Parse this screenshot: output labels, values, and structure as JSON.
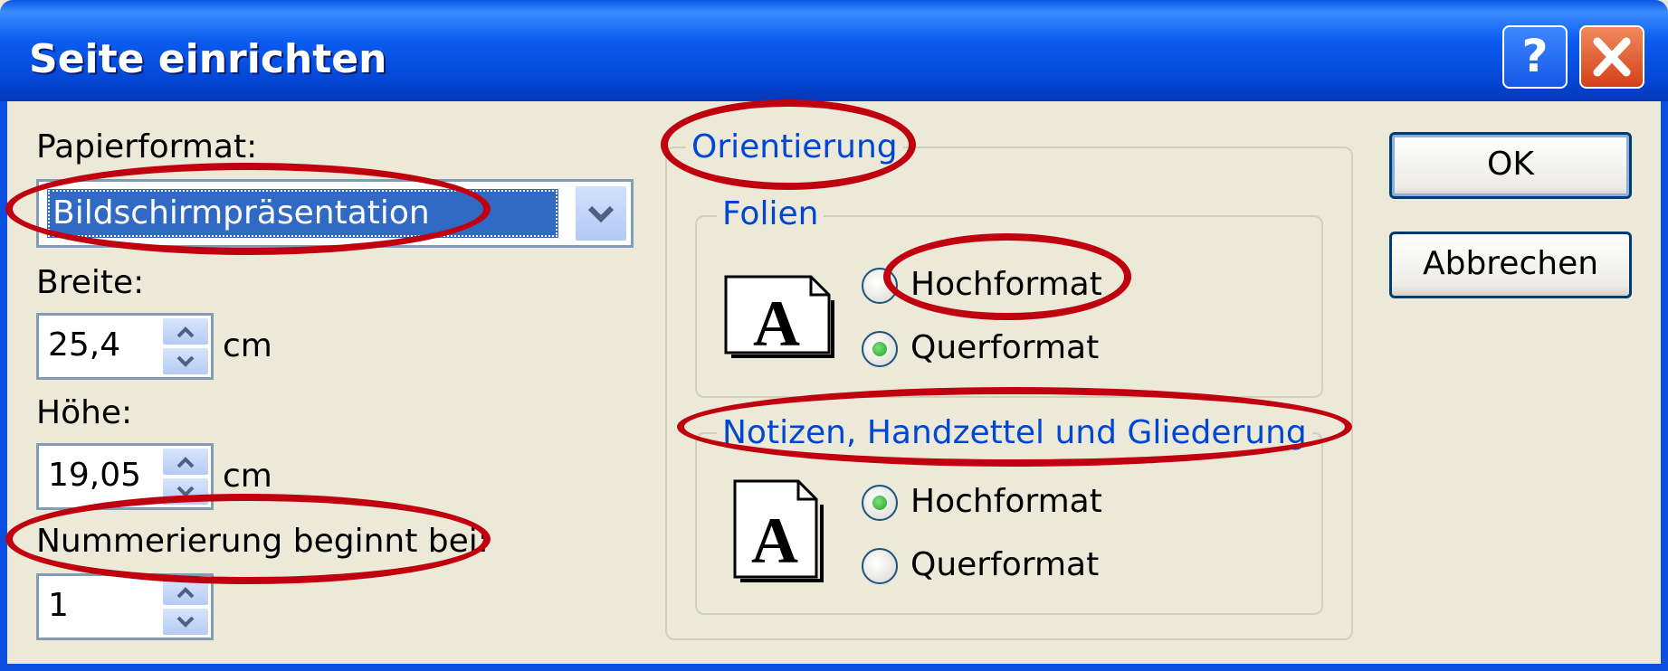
{
  "window": {
    "title": "Seite einrichten",
    "help_label": "?",
    "close_label": "✕"
  },
  "left": {
    "paper_label": "Papierformat:",
    "paper_value": "Bildschirmpräsentation",
    "width_label": "Breite:",
    "width_value": "25,4",
    "width_unit": "cm",
    "height_label": "Höhe:",
    "height_value": "19,05",
    "height_unit": "cm",
    "numbering_label": "Nummerierung beginnt bei:",
    "numbering_value": "1"
  },
  "orientation": {
    "title": "Orientierung",
    "slides": {
      "title": "Folien",
      "portrait": "Hochformat",
      "landscape": "Querformat",
      "selected": "landscape"
    },
    "notes": {
      "title": "Notizen, Handzettel und Gliederung",
      "portrait": "Hochformat",
      "landscape": "Querformat",
      "selected": "portrait"
    },
    "page_glyph": "A"
  },
  "buttons": {
    "ok": "OK",
    "cancel": "Abbrechen"
  },
  "annotation_color": "#c0000e"
}
